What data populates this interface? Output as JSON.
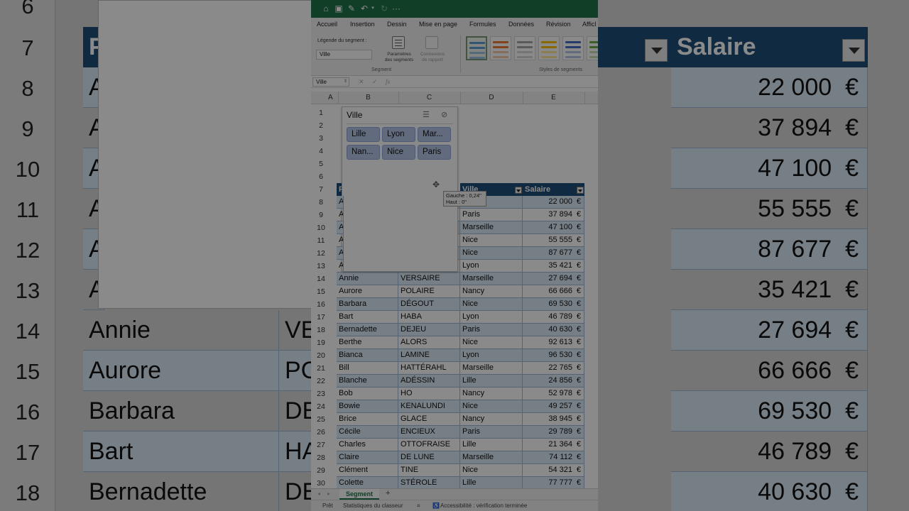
{
  "background": {
    "row_numbers": [
      "6",
      "7",
      "8",
      "9",
      "10",
      "11",
      "12",
      "13",
      "14",
      "15",
      "16",
      "17",
      "18"
    ],
    "header_fragment": "P",
    "salary_header": "Salaire",
    "left_letters": [
      "A",
      "A",
      "A",
      "A",
      "A",
      "A"
    ],
    "rows": [
      {
        "prenom": "Annie",
        "nom": "VE"
      },
      {
        "prenom": "Aurore",
        "nom": "PC"
      },
      {
        "prenom": "Barbara",
        "nom": "DE"
      },
      {
        "prenom": "Bart",
        "nom": "HA"
      },
      {
        "prenom": "Bernadette",
        "nom": "DE"
      }
    ],
    "salaries": [
      "22 000",
      "37 894",
      "47 100",
      "55 555",
      "87 677",
      "35 421",
      "27 694",
      "66 666",
      "69 530",
      "46 789",
      "40 630"
    ],
    "currency": "€"
  },
  "ribbon": {
    "tabs": [
      "Accueil",
      "Insertion",
      "Dessin",
      "Mise en page",
      "Formules",
      "Données",
      "Révision",
      "Afficl"
    ],
    "caption_label": "Légende du segment :",
    "caption_value": "Ville",
    "settings_label_1": "Paramètres",
    "settings_label_2": "des segments",
    "connections_label_1": "Connexions",
    "connections_label_2": "de rapport",
    "group_segment": "Segment",
    "group_styles": "Styles de segments"
  },
  "formula_bar": {
    "name_box": "Ville",
    "fx": "fx"
  },
  "columns": [
    "A",
    "B",
    "C",
    "D",
    "E"
  ],
  "slicer": {
    "title": "Ville",
    "items": [
      "Lille",
      "Lyon",
      "Mar...",
      "Nan...",
      "Nice",
      "Paris"
    ]
  },
  "tooltip": {
    "line1": "Gauche : 0,24\"",
    "line2": "Haut : 0\""
  },
  "table": {
    "header_fragment": "P",
    "headers": {
      "ville": "Ville",
      "salaire": "Salaire"
    },
    "first_letters": [
      "A",
      "A",
      "A",
      "A",
      "A",
      "A"
    ],
    "rows": [
      {
        "row": "8",
        "prenom": "",
        "nom": "",
        "ville": "",
        "salaire": "22 000"
      },
      {
        "row": "9",
        "prenom": "",
        "nom": "",
        "ville": "Paris",
        "salaire": "37 894"
      },
      {
        "row": "10",
        "prenom": "",
        "nom": "",
        "ville": "Marseille",
        "salaire": "47 100"
      },
      {
        "row": "11",
        "prenom": "",
        "nom": "",
        "ville": "Nice",
        "salaire": "55 555"
      },
      {
        "row": "12",
        "prenom": "",
        "nom": "",
        "ville": "Nice",
        "salaire": "87 677"
      },
      {
        "row": "13",
        "prenom": "",
        "nom": "",
        "ville": "Lyon",
        "salaire": "35 421"
      },
      {
        "row": "14",
        "prenom": "Annie",
        "nom": "VERSAIRE",
        "ville": "Marseille",
        "salaire": "27 694"
      },
      {
        "row": "15",
        "prenom": "Aurore",
        "nom": "POLAIRE",
        "ville": "Nancy",
        "salaire": "66 666"
      },
      {
        "row": "16",
        "prenom": "Barbara",
        "nom": "DÉGOUT",
        "ville": "Nice",
        "salaire": "69 530"
      },
      {
        "row": "17",
        "prenom": "Bart",
        "nom": "HABA",
        "ville": "Lyon",
        "salaire": "46 789"
      },
      {
        "row": "18",
        "prenom": "Bernadette",
        "nom": "DEJEU",
        "ville": "Paris",
        "salaire": "40 630"
      },
      {
        "row": "19",
        "prenom": "Berthe",
        "nom": "ALORS",
        "ville": "Nice",
        "salaire": "92 613"
      },
      {
        "row": "20",
        "prenom": "Bianca",
        "nom": "LAMINE",
        "ville": "Lyon",
        "salaire": "96 530"
      },
      {
        "row": "21",
        "prenom": "Bill",
        "nom": "HATTÉRAHL",
        "ville": "Marseille",
        "salaire": "22 765"
      },
      {
        "row": "22",
        "prenom": "Blanche",
        "nom": "ADÉSSIN",
        "ville": "Lille",
        "salaire": "24 856"
      },
      {
        "row": "23",
        "prenom": "Bob",
        "nom": "HO",
        "ville": "Nancy",
        "salaire": "52 978"
      },
      {
        "row": "24",
        "prenom": "Bowie",
        "nom": "KENALUNDI",
        "ville": "Nice",
        "salaire": "49 257"
      },
      {
        "row": "25",
        "prenom": "Brice",
        "nom": "GLACE",
        "ville": "Nancy",
        "salaire": "38 945"
      },
      {
        "row": "26",
        "prenom": "Cécile",
        "nom": "ENCIEUX",
        "ville": "Paris",
        "salaire": "29 789"
      },
      {
        "row": "27",
        "prenom": "Charles",
        "nom": "OTTOFRAISE",
        "ville": "Lille",
        "salaire": "21 364"
      },
      {
        "row": "28",
        "prenom": "Claire",
        "nom": "DE LUNE",
        "ville": "Marseille",
        "salaire": "74 112"
      },
      {
        "row": "29",
        "prenom": "Clément",
        "nom": "TINE",
        "ville": "Nice",
        "salaire": "54 321"
      },
      {
        "row": "30",
        "prenom": "Colette",
        "nom": "STÉROLE",
        "ville": "Lille",
        "salaire": "77 777"
      }
    ],
    "currency": "€"
  },
  "row_numbers_top": [
    "1",
    "2",
    "3",
    "4",
    "5",
    "6",
    "7"
  ],
  "sheet_tab": "Segment",
  "status": {
    "ready": "Prêt",
    "stats": "Statistiques du classeur",
    "accessibility": "Accessibilité : vérification terminée"
  },
  "colors": {
    "excel_green": "#217346",
    "table_header": "#1f4e79",
    "band": "#ddebf7",
    "slicer_item": "#b4c6e7"
  }
}
